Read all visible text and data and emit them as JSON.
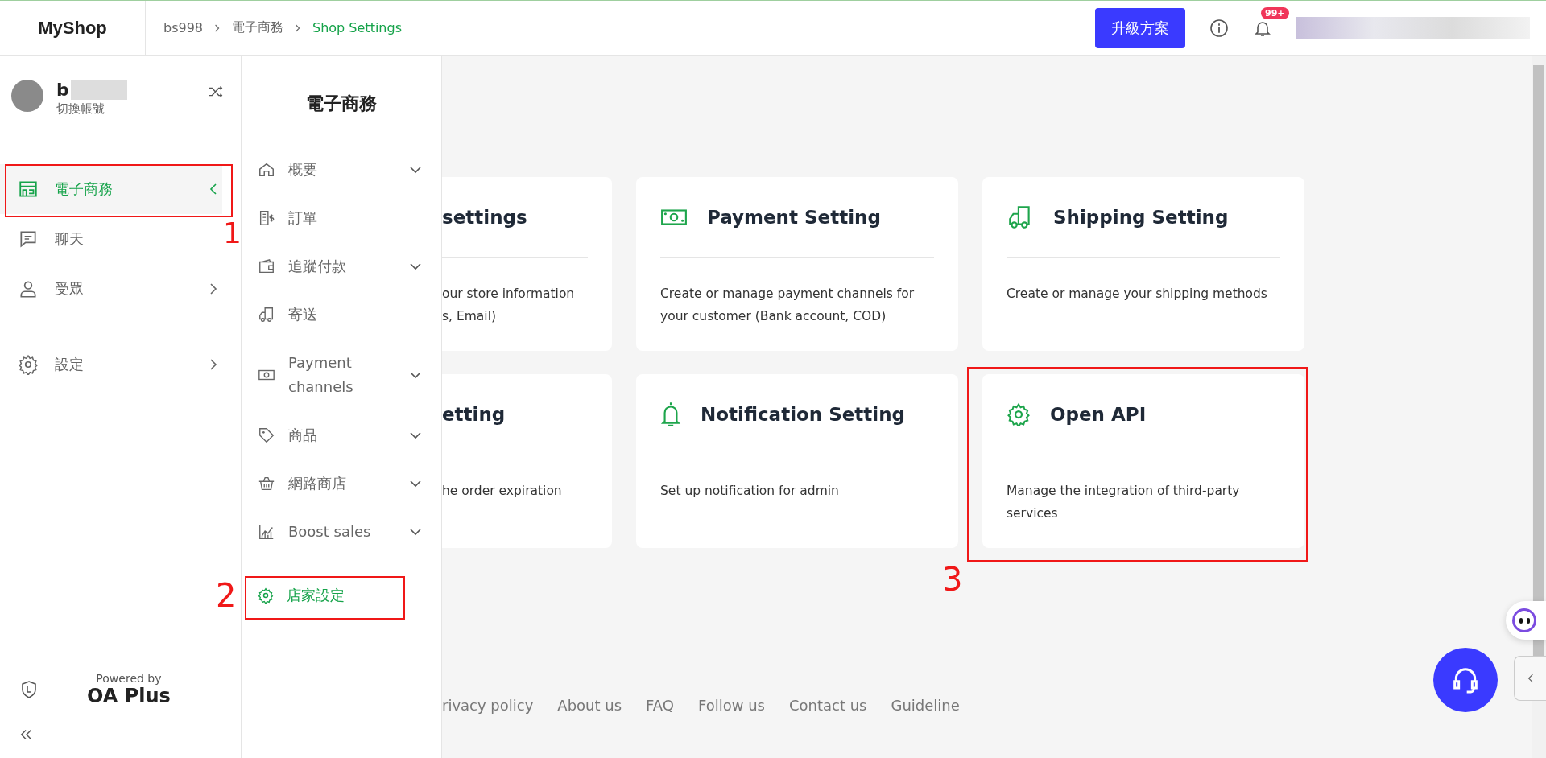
{
  "topbar": {
    "logo": "MyShop",
    "breadcrumb": [
      {
        "label": "bs998",
        "selected": false
      },
      {
        "label": "電子商務",
        "selected": false
      },
      {
        "label": "Shop Settings",
        "selected": true
      }
    ],
    "upgrade_button": "升級方案",
    "notification_badge": "99+"
  },
  "account": {
    "name": "b",
    "switch_label": "切換帳號"
  },
  "sidebar": {
    "items": [
      {
        "label": "電子商務",
        "selected": true,
        "has_submenu": true,
        "expanded": true
      },
      {
        "label": "聊天",
        "selected": false,
        "has_submenu": false
      },
      {
        "label": "受眾",
        "selected": false,
        "has_submenu": true,
        "expanded": false
      },
      {
        "label": "設定",
        "selected": false,
        "has_submenu": true,
        "expanded": false
      }
    ],
    "powered_by": "Powered by",
    "brand": "OA Plus"
  },
  "submenu": {
    "title": "電子商務",
    "items": [
      {
        "label": "概要",
        "selected": false,
        "expandable": true
      },
      {
        "label": "訂單",
        "selected": false,
        "expandable": false
      },
      {
        "label": "追蹤付款",
        "selected": false,
        "expandable": true
      },
      {
        "label": "寄送",
        "selected": false,
        "expandable": false
      },
      {
        "label": "Payment channels",
        "selected": false,
        "expandable": true
      },
      {
        "label": "商品",
        "selected": false,
        "expandable": true
      },
      {
        "label": "網路商店",
        "selected": false,
        "expandable": true
      },
      {
        "label": "Boost sales",
        "selected": false,
        "expandable": true
      },
      {
        "label": "店家設定",
        "selected": true,
        "expandable": false
      }
    ]
  },
  "cards": [
    {
      "kind": "partial",
      "title": "settings",
      "description": [
        "our store information",
        "s, Email)"
      ]
    },
    {
      "kind": "full",
      "title": "Payment Setting",
      "description": [
        "Create or manage payment channels for",
        "your customer (Bank account, COD)"
      ]
    },
    {
      "kind": "full",
      "title": "Shipping Setting",
      "description": [
        "Create or manage your shipping methods"
      ]
    },
    {
      "kind": "partial",
      "title": "etting",
      "description": [
        "he order expiration"
      ]
    },
    {
      "kind": "full",
      "title": "Notification Setting",
      "description": [
        "Set up notification for admin"
      ]
    },
    {
      "kind": "full",
      "title": "Open API",
      "description": [
        "Manage the integration of third-party",
        "services"
      ]
    }
  ],
  "footer_links": [
    "rivacy policy",
    "About us",
    "FAQ",
    "Follow us",
    "Contact us",
    "Guideline"
  ],
  "annotations": [
    {
      "label": "1"
    },
    {
      "label": "2"
    },
    {
      "label": "3"
    }
  ]
}
